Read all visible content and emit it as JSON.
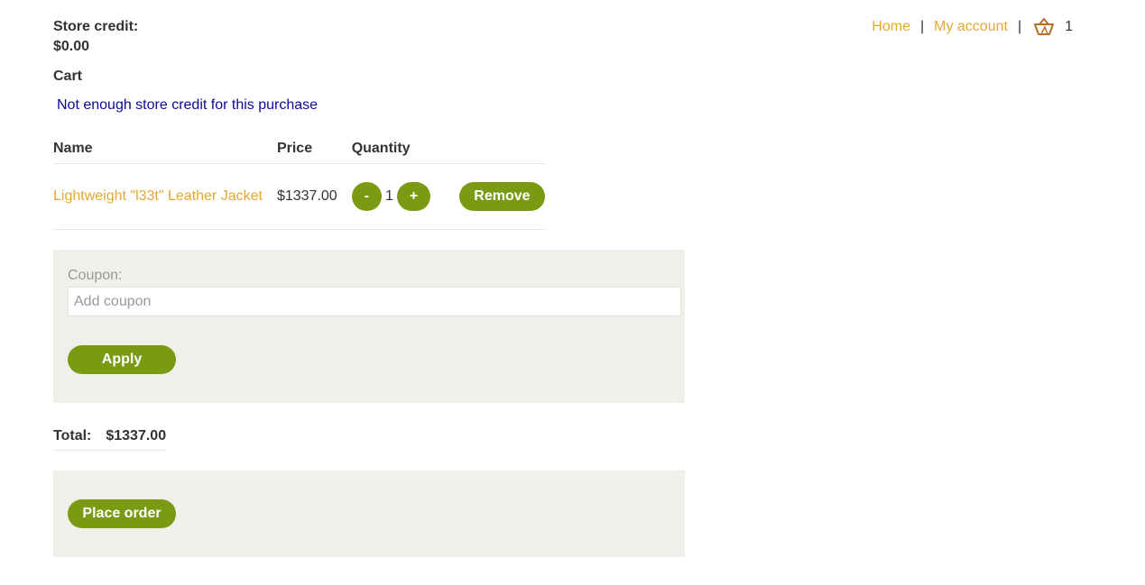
{
  "account": {
    "store_credit_label": "Store credit:",
    "store_credit_value": "$0.00"
  },
  "nav": {
    "home": "Home",
    "separator": "|",
    "my_account": "My account",
    "cart_count": "1",
    "cart_icon": "basket-icon"
  },
  "cart": {
    "heading": "Cart",
    "error": "Not enough store credit for this purchase",
    "columns": [
      "Name",
      "Price",
      "Quantity"
    ],
    "items": [
      {
        "name": "Lightweight \"l33t\" Leather Jacket",
        "price": "$1337.00",
        "quantity": "1",
        "decrement_label": "-",
        "increment_label": "+",
        "remove_label": "Remove"
      }
    ]
  },
  "coupon": {
    "label": "Coupon:",
    "placeholder": "Add coupon",
    "value": "",
    "apply_label": "Apply"
  },
  "total": {
    "label": "Total:",
    "amount": "$1337.00"
  },
  "order": {
    "place_order_label": "Place order"
  },
  "colors": {
    "accent": "#7a9a14",
    "link": "#e4a831",
    "error": "#0a0a9a",
    "panel": "#f0efe9"
  }
}
